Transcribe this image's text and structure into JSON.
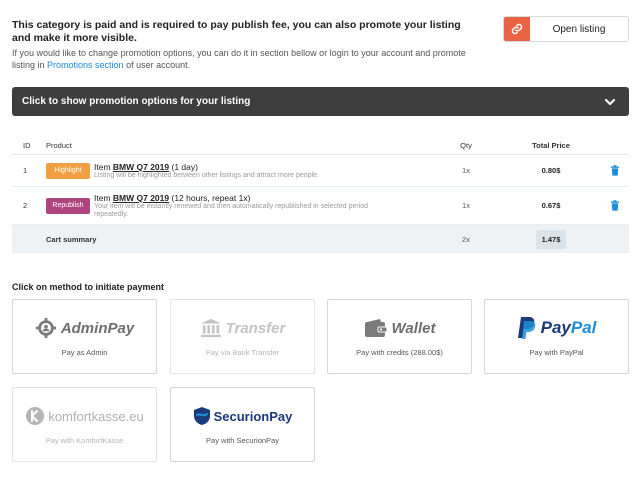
{
  "notice": {
    "title": "This category is paid and is required to pay publish fee, you can also promote your listing and make it more visible.",
    "text_before": "If you would like to change promotion options, you can do it in section bellow or login to your account and promote listing in",
    "link": "Promotions section",
    "text_after": "of user account."
  },
  "open_listing": {
    "label": "Open listing",
    "icon": "link-icon",
    "accent": "#e86344"
  },
  "promo_bar": {
    "label": "Click to show promotion options for your listing",
    "icon": "chevron-down-icon"
  },
  "cart": {
    "headers": {
      "id": "ID",
      "product": "Product",
      "qty": "Qty",
      "total": "Total Price"
    },
    "rows": [
      {
        "id": "1",
        "badge": "Highlight",
        "badge_color": "#f0a042",
        "prefix": "Item",
        "name": "BMW Q7 2019",
        "suffix": "(1 day)",
        "desc": "Listing will be highlighted between other listings and attract more people.",
        "qty": "1x",
        "total": "0.80$"
      },
      {
        "id": "2",
        "badge": "Republish",
        "badge_color": "#b0447e",
        "prefix": "Item",
        "name": "BMW Q7 2019",
        "suffix": "(12 hours, repeat 1x)",
        "desc": "Your item will be instantly renewed and then automatically republished in selected period repeatedly.",
        "qty": "1x",
        "total": "0.67$"
      }
    ],
    "summary": {
      "label": "Cart summary",
      "qty": "2x",
      "total": "1.47$"
    }
  },
  "payment": {
    "title": "Click on method to initiate payment",
    "methods": [
      {
        "logo": "AdminPay",
        "caption": "Pay as Admin",
        "icon": "gear-icon",
        "enabled": true
      },
      {
        "logo": "Transfer",
        "caption": "Pay via Bank Transfer",
        "icon": "bank-icon",
        "enabled": false
      },
      {
        "logo": "Wallet",
        "caption": "Pay with credits (288.00$)",
        "icon": "wallet-icon",
        "enabled": true
      },
      {
        "logo_part1": "Pay",
        "logo_part2": "Pal",
        "caption": "Pay with PayPal",
        "icon": "paypal-icon",
        "enabled": true
      },
      {
        "logo": "komfortkasse.eu",
        "caption": "Pay with KomfortKasse",
        "icon": "komfortkasse-icon",
        "enabled": false
      },
      {
        "logo_part1": "Securion",
        "logo_part2": "Pay",
        "caption": "Pay with SecurionPay",
        "icon": "securionpay-icon",
        "enabled": true
      }
    ]
  },
  "colors": {
    "paypal_dark": "#1b3a7a",
    "paypal_light": "#1d8fd6",
    "delete": "#1a8cd8",
    "bar": "#3e3e3e"
  }
}
